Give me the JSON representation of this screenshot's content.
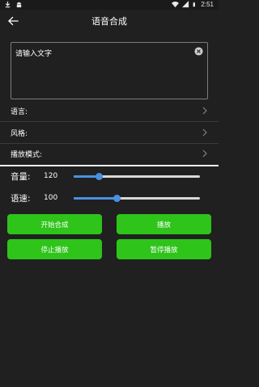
{
  "status_bar": {
    "time": "2:51",
    "left_icons": [
      "download-icon",
      "android-icon"
    ],
    "right_icons": [
      "wifi-icon",
      "signal-icon",
      "battery-icon"
    ]
  },
  "app_bar": {
    "title": "语音合成",
    "back_icon": "back-arrow-icon"
  },
  "text_input": {
    "placeholder": "请输入文字",
    "clear_icon": "clear-icon"
  },
  "options": [
    {
      "label": "语言:"
    },
    {
      "label": "风格:"
    },
    {
      "label": "播放模式:"
    }
  ],
  "sliders": {
    "volume": {
      "label": "音量:",
      "value": "120",
      "fraction": 0.2
    },
    "speed": {
      "label": "语速:",
      "value": "100",
      "fraction": 0.34
    }
  },
  "buttons": {
    "start_synthesis": "开始合成",
    "play": "播放",
    "stop_play": "停止播放",
    "pause_play": "暂停播放"
  },
  "colors": {
    "background": "#202020",
    "button_green": "#2ec41a",
    "slider_accent": "#4a90e2",
    "border": "#7c7c7c"
  }
}
